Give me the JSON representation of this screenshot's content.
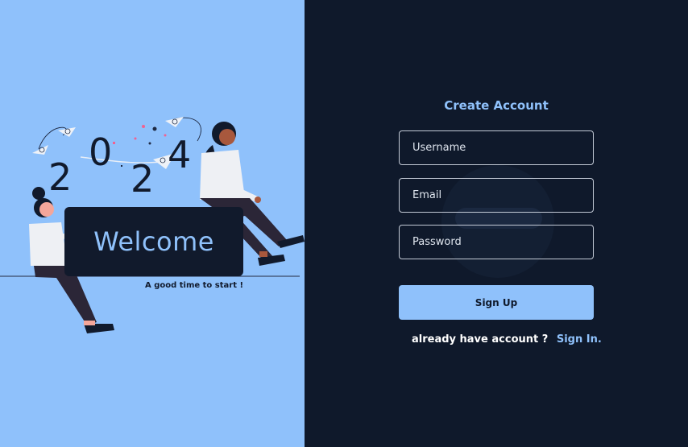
{
  "hero": {
    "year_digits": [
      "2",
      "0",
      "2",
      "4"
    ],
    "welcome_text": "Welcome",
    "tagline": "A good time to start !"
  },
  "form": {
    "title": "Create Account",
    "username_placeholder": "Username",
    "email_placeholder": "Email",
    "password_placeholder": "Password",
    "submit_label": "Sign Up",
    "signin_prompt": "already have account ?",
    "signin_link": "Sign In."
  },
  "colors": {
    "left_background": "#8fc1fb",
    "right_background": "#0f192b",
    "accent": "#8fc1fb",
    "board": "#111a2c"
  },
  "icons": [
    "paper-plane-icon",
    "person-sitting-icon",
    "person-leaning-icon",
    "confetti-icon"
  ]
}
